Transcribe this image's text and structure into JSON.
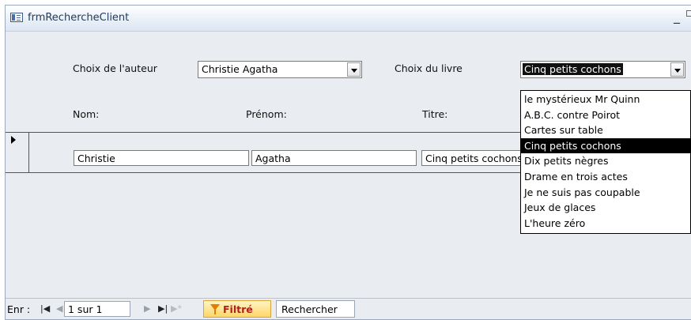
{
  "window": {
    "title": "frmRechercheClient",
    "minimize_glyph": "_"
  },
  "form": {
    "author_label": "Choix de l'auteur",
    "author_value": "Christie Agatha",
    "book_label": "Choix du livre",
    "book_value": "Cinq petits cochons",
    "book_options": [
      "le mystérieux Mr Quinn",
      "A.B.C. contre Poirot",
      "Cartes sur table",
      "Cinq petits cochons",
      "Dix petits nègres",
      "Drame en trois actes",
      "Je ne suis pas coupable",
      "Jeux de glaces",
      "L'heure zéro"
    ],
    "selected_book_index": 3
  },
  "columns": {
    "nom": "Nom:",
    "prenom": "Prénom:",
    "titre": "Titre:"
  },
  "record": {
    "nom": "Christie",
    "prenom": "Agatha",
    "titre": "Cinq petits cochons"
  },
  "navigation": {
    "label": "Enr :",
    "first_glyph": "|◀",
    "prev_glyph": "◀",
    "position": "1 sur 1",
    "next_glyph": "▶",
    "last_glyph": "▶|",
    "new_glyph": "▶*",
    "filter_label": "Filtré",
    "search_label": "Rechercher"
  }
}
